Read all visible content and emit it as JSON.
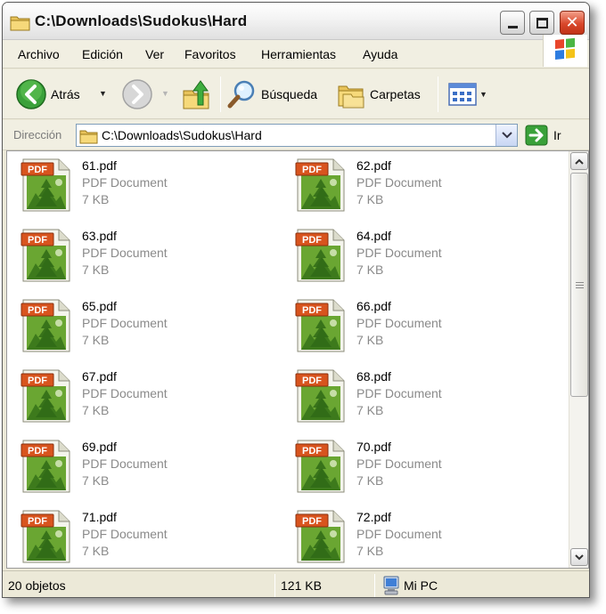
{
  "window": {
    "title": "C:\\Downloads\\Sudokus\\Hard"
  },
  "menu": [
    "Archivo",
    "Edición",
    "Ver",
    "Favoritos",
    "Herramientas",
    "Ayuda"
  ],
  "toolbar": {
    "back_label": "Atrás",
    "search_label": "Búsqueda",
    "folders_label": "Carpetas"
  },
  "address": {
    "label": "Dirección",
    "path": "C:\\Downloads\\Sudokus\\Hard",
    "go_label": "Ir"
  },
  "files": [
    {
      "name": "61.pdf",
      "type": "PDF Document",
      "size": "7 KB"
    },
    {
      "name": "62.pdf",
      "type": "PDF Document",
      "size": "7 KB"
    },
    {
      "name": "63.pdf",
      "type": "PDF Document",
      "size": "7 KB"
    },
    {
      "name": "64.pdf",
      "type": "PDF Document",
      "size": "7 KB"
    },
    {
      "name": "65.pdf",
      "type": "PDF Document",
      "size": "7 KB"
    },
    {
      "name": "66.pdf",
      "type": "PDF Document",
      "size": "7 KB"
    },
    {
      "name": "67.pdf",
      "type": "PDF Document",
      "size": "7 KB"
    },
    {
      "name": "68.pdf",
      "type": "PDF Document",
      "size": "7 KB"
    },
    {
      "name": "69.pdf",
      "type": "PDF Document",
      "size": "7 KB"
    },
    {
      "name": "70.pdf",
      "type": "PDF Document",
      "size": "7 KB"
    },
    {
      "name": "71.pdf",
      "type": "PDF Document",
      "size": "7 KB"
    },
    {
      "name": "72.pdf",
      "type": "PDF Document",
      "size": "7 KB"
    }
  ],
  "file_icon": {
    "badge": "PDF",
    "name": "pdf-icon"
  },
  "status": {
    "count": "20 objetos",
    "size": "121 KB",
    "location": "Mi PC"
  },
  "colors": {
    "close_button": "#d9472b",
    "pdf_badge": "#d8541e",
    "icon_green": "#5d9b2b",
    "back_green": "#2f8f2f"
  }
}
